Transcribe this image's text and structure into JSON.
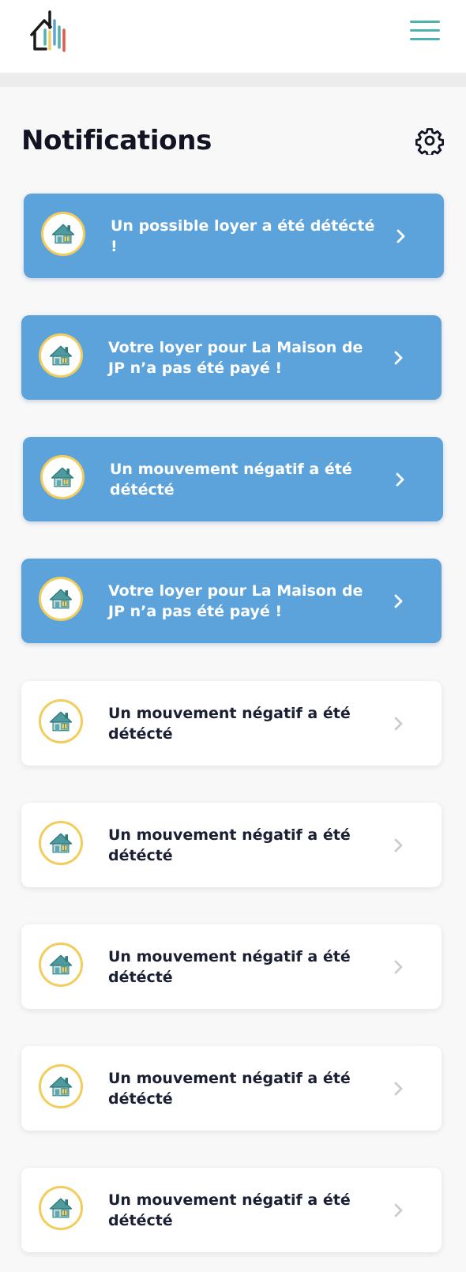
{
  "header": {
    "logo_icon": "house-chart-logo-icon",
    "menu_icon": "hamburger-menu-icon",
    "menu_color": "#4eb3b0"
  },
  "page": {
    "title": "Notifications",
    "settings_icon": "gear-icon"
  },
  "colors": {
    "unread_card": "#5ca3dc",
    "read_card": "#ffffff",
    "avatar_ring": "#f3cd5b",
    "house_roof": "#3c8e90",
    "house_window": "#f3cd5b"
  },
  "notifications": [
    {
      "text": "Un possible loyer a été détécté !",
      "read": false,
      "icon": "house-icon"
    },
    {
      "text": "Votre loyer pour La Maison de JP n’a pas été payé !",
      "read": false,
      "icon": "house-icon"
    },
    {
      "text": "Un mouvement négatif a été détécté",
      "read": false,
      "icon": "house-icon"
    },
    {
      "text": "Votre loyer pour La Maison de JP n’a pas été payé !",
      "read": false,
      "icon": "house-icon"
    },
    {
      "text": "Un mouvement négatif a été détécté",
      "read": true,
      "icon": "house-icon"
    },
    {
      "text": "Un mouvement négatif a été détécté",
      "read": true,
      "icon": "house-icon"
    },
    {
      "text": "Un mouvement négatif a été détécté",
      "read": true,
      "icon": "house-icon"
    },
    {
      "text": "Un mouvement négatif a été détécté",
      "read": true,
      "icon": "house-icon"
    },
    {
      "text": "Un mouvement négatif a été détécté",
      "read": true,
      "icon": "house-icon"
    }
  ]
}
